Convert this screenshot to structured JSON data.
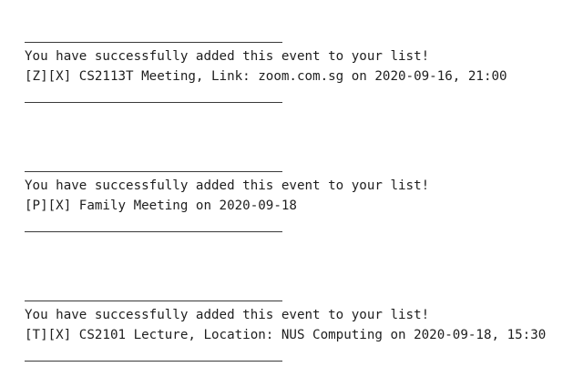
{
  "responses": [
    {
      "message": "You have successfully added this event to your list!",
      "detail": "[Z][X] CS2113T Meeting, Link: zoom.com.sg on 2020-09-16, 21:00"
    },
    {
      "message": "You have successfully added this event to your list!",
      "detail": "[P][X] Family Meeting on 2020-09-18"
    },
    {
      "message": "You have successfully added this event to your list!",
      "detail": "[T][X] CS2101 Lecture, Location: NUS Computing on 2020-09-18, 15:30"
    }
  ]
}
